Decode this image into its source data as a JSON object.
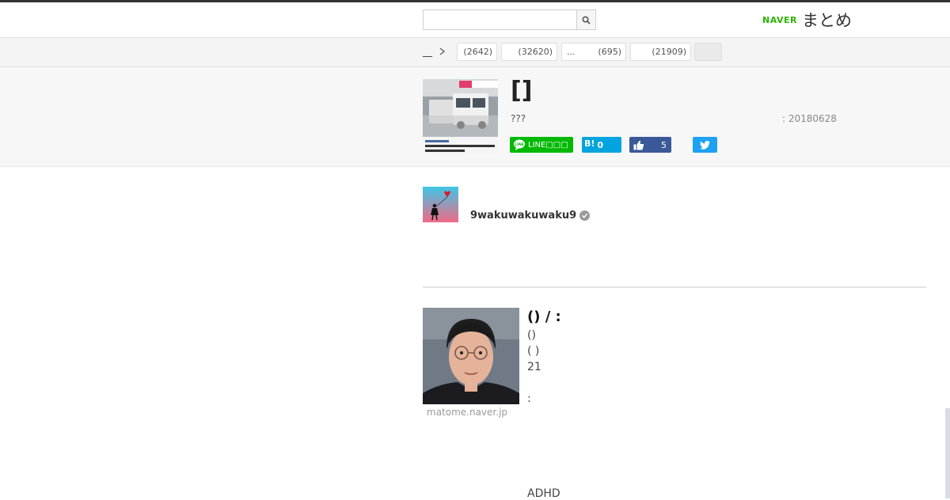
{
  "header": {
    "search_placeholder": "",
    "logo_brand": "NAVER",
    "logo_service": "まとめ"
  },
  "breadcrumb": {
    "label": "__",
    "categories": [
      {
        "name": "",
        "count": "(2642)"
      },
      {
        "name": "",
        "count": "(32620)"
      },
      {
        "name": "...",
        "count": "(695)"
      },
      {
        "name": "",
        "count": "(21909)"
      }
    ]
  },
  "article": {
    "title": "[]",
    "description": "???",
    "date": ": 20180628"
  },
  "share": {
    "line_label": "LINE□□□",
    "hatena_mark": "B!",
    "hatena_count": "0",
    "like_count": "5"
  },
  "author": {
    "name": "9wakuwakuwaku9"
  },
  "item": {
    "heading": "() / :",
    "lines": [
      "()",
      "( )",
      "21",
      ""
    ],
    "colon_line": ":",
    "source": "matome.naver.jp",
    "footer_text": "ADHD"
  },
  "colors": {
    "line_green": "#00b900",
    "hatena_blue": "#00a4de",
    "facebook_blue": "#3b5998",
    "twitter_blue": "#1da1f2",
    "naver_green": "#2db400"
  }
}
